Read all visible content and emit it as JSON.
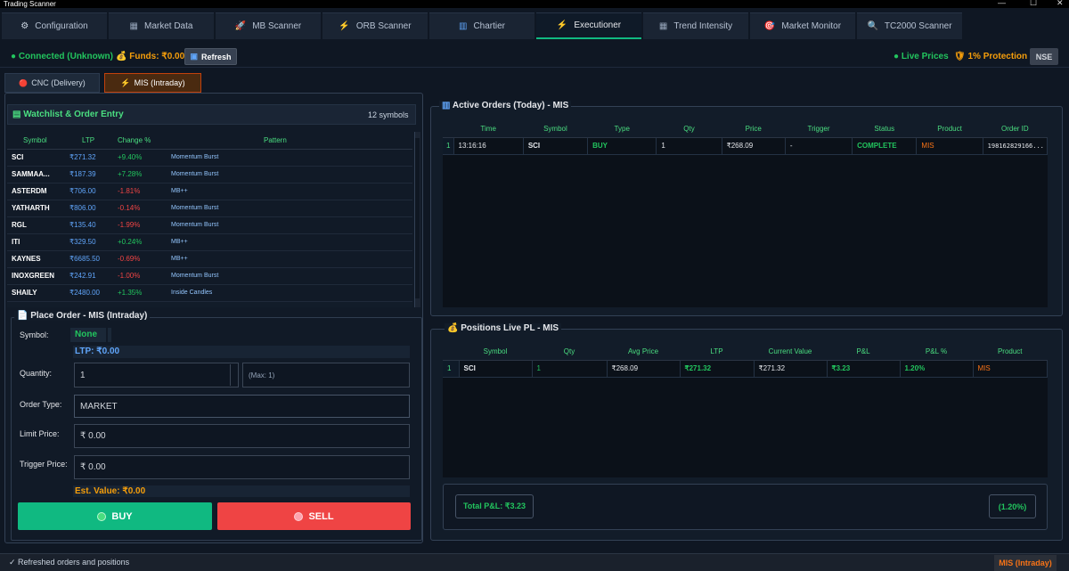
{
  "app": {
    "title": "Trading Scanner",
    "window_controls": [
      "—",
      "☐",
      "✕"
    ]
  },
  "tabs": [
    {
      "icon": "⚙",
      "label": "Configuration"
    },
    {
      "icon": "▦",
      "label": "Market Data"
    },
    {
      "icon": "🚀",
      "label": "MB Scanner"
    },
    {
      "icon": "⚡",
      "label": "ORB Scanner"
    },
    {
      "icon": "▥",
      "label": "Chartier"
    },
    {
      "icon": "⚡",
      "label": "Executioner"
    },
    {
      "icon": "▦",
      "label": "Trend Intensity"
    },
    {
      "icon": "🎯",
      "label": "Market Monitor"
    },
    {
      "icon": "🔍",
      "label": "TC2000 Scanner"
    }
  ],
  "status": {
    "connection": "● Connected (Unknown)",
    "funds": "💰 Funds: ₹0.00",
    "refresh_label": "Refresh",
    "live_prices": "● Live Prices",
    "protection": "🛡 1% Protection",
    "exchange": "NSE"
  },
  "subtabs": [
    {
      "icon": "🔴",
      "label": "CNC (Delivery)"
    },
    {
      "icon": "⚡",
      "label": "MIS (Intraday)"
    }
  ],
  "watchlist": {
    "title": "▤ Watchlist & Order Entry",
    "count": "12 symbols",
    "headers": [
      "Symbol",
      "LTP",
      "Change %",
      "Pattern"
    ],
    "rows": [
      {
        "symbol": "SCI",
        "ltp": "₹271.32",
        "change": "+9.40%",
        "dir": "pos",
        "pattern": "Momentum Burst"
      },
      {
        "symbol": "SAMMAA...",
        "ltp": "₹187.39",
        "change": "+7.28%",
        "dir": "pos",
        "pattern": "Momentum Burst"
      },
      {
        "symbol": "ASTERDM",
        "ltp": "₹706.00",
        "change": "-1.81%",
        "dir": "neg",
        "pattern": "MB++"
      },
      {
        "symbol": "YATHARTH",
        "ltp": "₹806.00",
        "change": "-0.14%",
        "dir": "neg",
        "pattern": "Momentum Burst"
      },
      {
        "symbol": "RGL",
        "ltp": "₹135.40",
        "change": "-1.99%",
        "dir": "neg",
        "pattern": "Momentum Burst"
      },
      {
        "symbol": "ITI",
        "ltp": "₹329.50",
        "change": "+0.24%",
        "dir": "pos",
        "pattern": "MB++"
      },
      {
        "symbol": "KAYNES",
        "ltp": "₹6685.50",
        "change": "-0.69%",
        "dir": "neg",
        "pattern": "MB++"
      },
      {
        "symbol": "INOXGREEN",
        "ltp": "₹242.91",
        "change": "-1.00%",
        "dir": "neg",
        "pattern": "Momentum Burst"
      },
      {
        "symbol": "SHAILY",
        "ltp": "₹2480.00",
        "change": "+1.35%",
        "dir": "pos",
        "pattern": "Inside Candles"
      }
    ]
  },
  "place_order": {
    "title": "📄 Place Order - MIS (Intraday)",
    "symbol_label": "Symbol:",
    "symbol_value": "None",
    "ltp_text": "LTP: ₹0.00",
    "quantity_label": "Quantity:",
    "quantity_value": "1",
    "max_text": "(Max: 1)",
    "order_type_label": "Order Type:",
    "order_type_value": "MARKET",
    "limit_label": "Limit Price:",
    "limit_value": "₹ 0.00",
    "trigger_label": "Trigger Price:",
    "trigger_value": "₹ 0.00",
    "est_value": "Est. Value: ₹0.00",
    "buy_label": "BUY",
    "sell_label": "SELL"
  },
  "active_orders": {
    "title": "Active Orders (Today) - MIS",
    "headers": [
      "Time",
      "Symbol",
      "Type",
      "Qty",
      "Price",
      "Trigger",
      "Status",
      "Product",
      "Order ID"
    ],
    "rows": [
      {
        "n": "1",
        "time": "13:16:16",
        "symbol": "SCI",
        "type": "BUY",
        "qty": "1",
        "price": "₹268.09",
        "trigger": "-",
        "status": "COMPLETE",
        "product": "MIS",
        "order_id": "198162829166..."
      }
    ]
  },
  "positions": {
    "title": "Positions Live PL - MIS",
    "headers": [
      "Symbol",
      "Qty",
      "Avg Price",
      "LTP",
      "Current Value",
      "P&L",
      "P&L %",
      "Product"
    ],
    "rows": [
      {
        "n": "1",
        "symbol": "SCI",
        "qty": "1",
        "avg": "₹268.09",
        "ltp": "₹271.32",
        "value": "₹271.32",
        "pl": "₹3.23",
        "plpct": "1.20%",
        "product": "MIS"
      }
    ],
    "total_pl": "Total P&L: ₹3.23",
    "total_pct": "(1.20%)"
  },
  "footer": {
    "message": "✓ Refreshed orders and positions",
    "mode": "MIS (Intraday)"
  },
  "colors": {
    "accent_green": "#10b981",
    "sell_red": "#ef4444",
    "mis_orange": "#f97316"
  }
}
